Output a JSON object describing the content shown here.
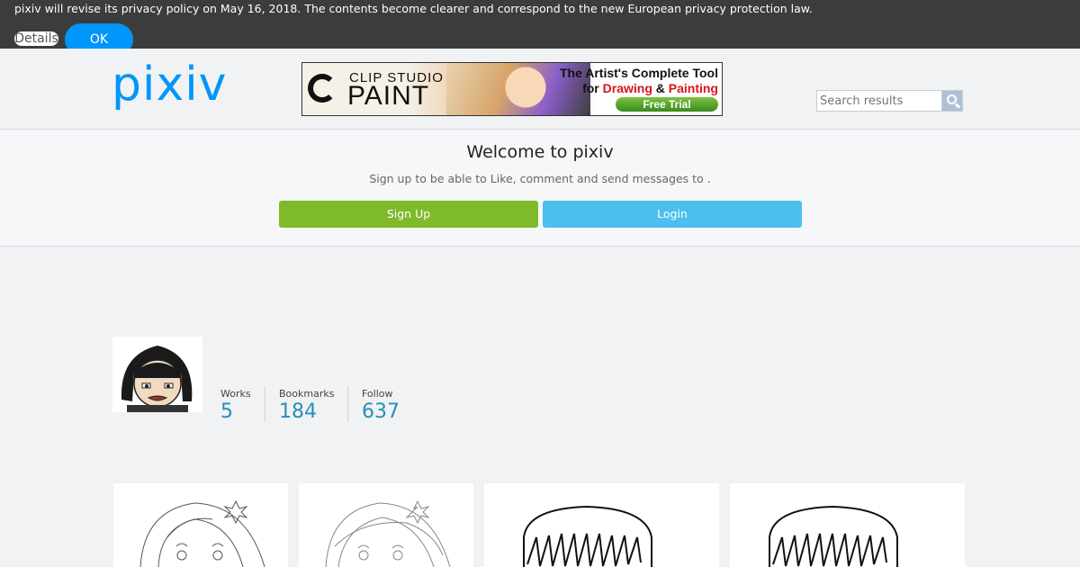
{
  "privacy_banner": {
    "text": "pixiv will revise its privacy policy on May 16, 2018. The contents become clearer and correspond to the new European privacy protection law.",
    "details_label": "Details",
    "ok_label": "OK"
  },
  "header": {
    "logo_text": "pixiv",
    "ad": {
      "brand_top": "CLIP STUDIO",
      "brand": "PAINT",
      "line1": "The Artist's Complete Tool",
      "line2_prefix": "for ",
      "line2_highlight_a": "Drawing",
      "line2_middle": " & ",
      "line2_highlight_b": "Painting",
      "cta": "Free Trial"
    },
    "search": {
      "placeholder": "Search results",
      "icon": "search-icon"
    }
  },
  "welcome": {
    "title": "Welcome to pixiv",
    "subtitle": "Sign up to be able to Like, comment and send messages to .",
    "signup_label": "Sign Up",
    "login_label": "Login"
  },
  "profile": {
    "stats": [
      {
        "label": "Works",
        "value": "5"
      },
      {
        "label": "Bookmarks",
        "value": "184"
      },
      {
        "label": "Follow",
        "value": "637"
      }
    ]
  },
  "colors": {
    "accent": "#0096fa",
    "banner_bg": "#3c3c3c",
    "signup": "#7fba2b",
    "login": "#4cbfee",
    "stat_value": "#258fb8"
  }
}
